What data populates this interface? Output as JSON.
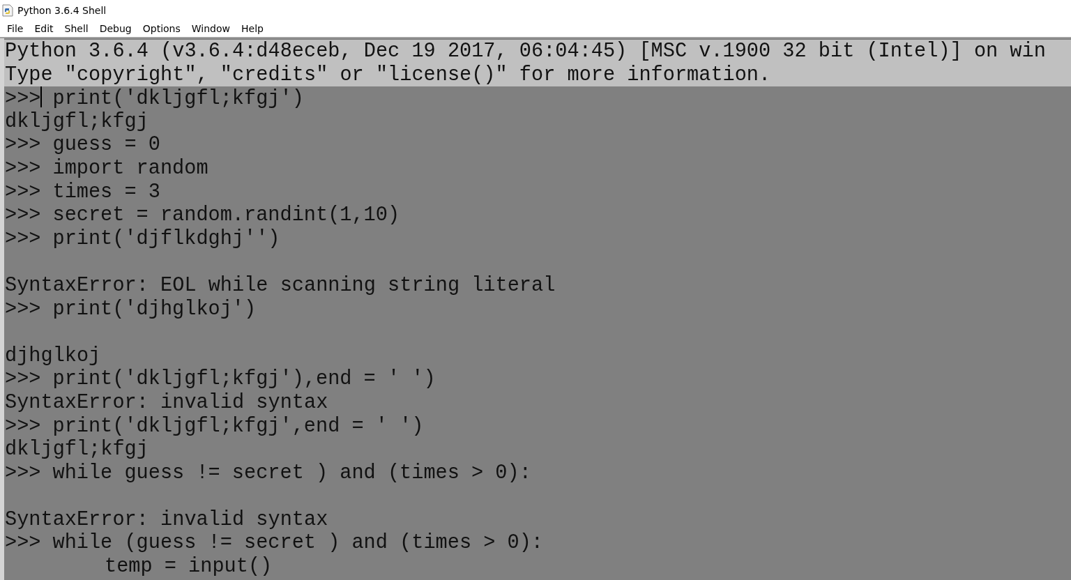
{
  "window": {
    "title": "Python 3.6.4 Shell"
  },
  "menu": [
    "File",
    "Edit",
    "Shell",
    "Debug",
    "Options",
    "Window",
    "Help"
  ],
  "lines": [
    {
      "kind": "banner",
      "text": "Python 3.6.4 (v3.6.4:d48eceb, Dec 19 2017, 06:04:45) [MSC v.1900 32 bit (Intel)] on win"
    },
    {
      "kind": "banner",
      "text": "Type \"copyright\", \"credits\" or \"license()\" for more information."
    },
    {
      "kind": "input",
      "prompt": ">>>",
      "code": "print('dkljgfl;kfgj')",
      "cursor": true
    },
    {
      "kind": "output",
      "text": "dkljgfl;kfgj"
    },
    {
      "kind": "input",
      "prompt": ">>>",
      "code": "guess = 0",
      "cursor": false
    },
    {
      "kind": "input",
      "prompt": ">>>",
      "code": "import random",
      "cursor": false
    },
    {
      "kind": "input",
      "prompt": ">>>",
      "code": "times = 3",
      "cursor": false
    },
    {
      "kind": "input",
      "prompt": ">>>",
      "code": "secret = random.randint(1,10)",
      "cursor": false
    },
    {
      "kind": "input",
      "prompt": ">>>",
      "code": "print('djflkdghj'')",
      "cursor": false
    },
    {
      "kind": "blank"
    },
    {
      "kind": "output",
      "text": "SyntaxError: EOL while scanning string literal"
    },
    {
      "kind": "input",
      "prompt": ">>>",
      "code": "print('djhglkoj')",
      "cursor": false
    },
    {
      "kind": "blank"
    },
    {
      "kind": "output",
      "text": "djhglkoj"
    },
    {
      "kind": "input",
      "prompt": ">>>",
      "code": "print('dkljgfl;kfgj'),end = ' ')",
      "cursor": false
    },
    {
      "kind": "output",
      "text": "SyntaxError: invalid syntax"
    },
    {
      "kind": "input",
      "prompt": ">>>",
      "code": "print('dkljgfl;kfgj',end = ' ')",
      "cursor": false
    },
    {
      "kind": "output",
      "text": "dkljgfl;kfgj"
    },
    {
      "kind": "input",
      "prompt": ">>>",
      "code": "while guess != secret ) and (times > 0):",
      "cursor": false
    },
    {
      "kind": "blank"
    },
    {
      "kind": "output",
      "text": "SyntaxError: invalid syntax"
    },
    {
      "kind": "input",
      "prompt": ">>>",
      "code": "while (guess != secret ) and (times > 0):",
      "cursor": false
    },
    {
      "kind": "continuation",
      "text": "temp = input()"
    }
  ]
}
